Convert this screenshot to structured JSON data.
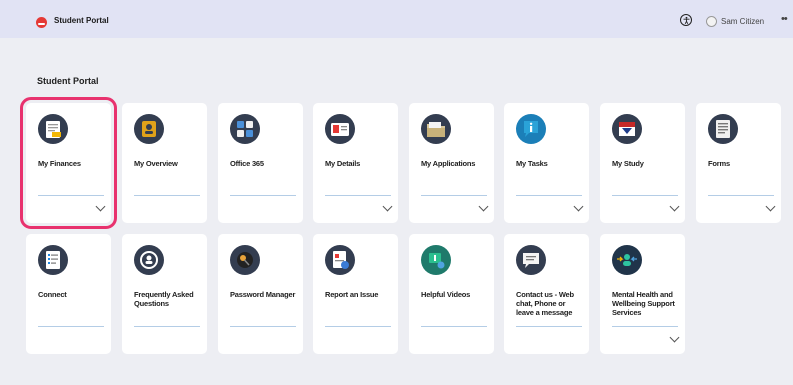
{
  "header": {
    "title": "Student Portal",
    "logo_icon": "student-portal-logo-icon",
    "accessibility_icon": "accessibility-icon",
    "user_name": "Sam Citizen",
    "more_label": "••"
  },
  "section": {
    "title": "Student Portal"
  },
  "tiles_row1": [
    {
      "label": "My Finances",
      "icon": "invoice-icon",
      "chevron": true,
      "selected": true
    },
    {
      "label": "My Overview",
      "icon": "profile-badge-icon",
      "chevron": false
    },
    {
      "label": "Office 365",
      "icon": "office-apps-icon",
      "chevron": false
    },
    {
      "label": "My Details",
      "icon": "id-card-icon",
      "chevron": true
    },
    {
      "label": "My Applications",
      "icon": "folder-icon",
      "chevron": true
    },
    {
      "label": "My Tasks",
      "icon": "info-chat-icon",
      "chevron": true
    },
    {
      "label": "My Study",
      "icon": "study-book-icon",
      "chevron": true
    },
    {
      "label": "Forms",
      "icon": "forms-icon",
      "chevron": true
    }
  ],
  "tiles_row2": [
    {
      "label": "Connect",
      "icon": "checklist-icon",
      "chevron": false
    },
    {
      "label": "Frequently Asked Questions",
      "icon": "faq-search-icon",
      "chevron": false
    },
    {
      "label": "Password Manager",
      "icon": "password-key-icon",
      "chevron": false
    },
    {
      "label": "Report an Issue",
      "icon": "report-issue-icon",
      "chevron": false
    },
    {
      "label": "Helpful Videos",
      "icon": "video-settings-icon",
      "chevron": false
    },
    {
      "label": "Contact us - Web chat, Phone or leave a message",
      "icon": "chat-bubble-icon",
      "chevron": false
    },
    {
      "label": "Mental Health and Wellbeing Support Services",
      "icon": "wellbeing-support-icon",
      "chevron": true
    }
  ],
  "colors": {
    "background": "#edeef3",
    "header": "#e1e3f4",
    "selection_outline": "#e8326e",
    "icon_circle": "#333d50",
    "divider": "#b4cde6"
  }
}
